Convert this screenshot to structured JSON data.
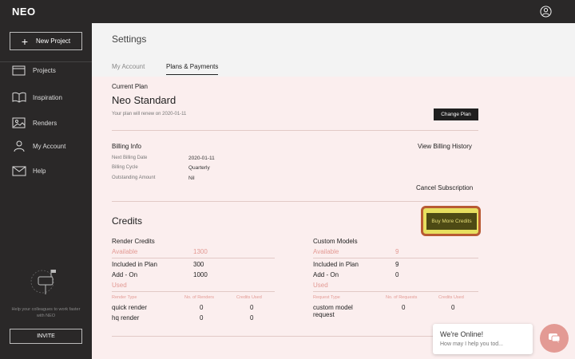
{
  "app": {
    "logo": "NEO"
  },
  "sidebar": {
    "new_project": "New Project",
    "items": [
      {
        "label": "Projects",
        "icon": "folder-icon"
      },
      {
        "label": "Inspiration",
        "icon": "book-icon"
      },
      {
        "label": "Renders",
        "icon": "image-icon"
      },
      {
        "label": "My Account",
        "icon": "user-icon"
      },
      {
        "label": "Help",
        "icon": "mail-icon"
      }
    ],
    "help_text": "Help your colleagues to work faster with NEO",
    "invite": "INVITE"
  },
  "settings": {
    "title": "Settings",
    "tabs": [
      {
        "label": "My Account"
      },
      {
        "label": "Plans & Payments",
        "active": true
      }
    ]
  },
  "plan": {
    "current_label": "Current Plan",
    "name": "Neo Standard",
    "renew_text": "Your plan will renew on 2020-01-11",
    "change_button": "Change Plan"
  },
  "billing": {
    "title": "Billing Info",
    "view_history": "View Billing History",
    "rows": [
      {
        "label": "Next Billing Date",
        "value": "2020-01-11"
      },
      {
        "label": "Billing Cycle",
        "value": "Quarterly"
      },
      {
        "label": "Outstanding Amount",
        "value": "Nil"
      }
    ],
    "cancel": "Cancel Subscription"
  },
  "credits": {
    "title": "Credits",
    "buy_button": "Buy More Credits",
    "render": {
      "title": "Render Credits",
      "available_label": "Available",
      "available_value": "1300",
      "included_label": "Included in Plan",
      "included_value": "300",
      "addon_label": "Add - On",
      "addon_value": "1000",
      "used_label": "Used",
      "cols": [
        "Render Type",
        "No. of Renders",
        "Credits Used"
      ],
      "rows": [
        {
          "type": "quick render",
          "count": "0",
          "credits": "0"
        },
        {
          "type": "hq render",
          "count": "0",
          "credits": "0"
        }
      ]
    },
    "custom": {
      "title": "Custom Models",
      "available_label": "Available",
      "available_value": "9",
      "included_label": "Included in Plan",
      "included_value": "9",
      "addon_label": "Add - On",
      "addon_value": "0",
      "used_label": "Used",
      "cols": [
        "Request   Type",
        "No. of Requests",
        "Credits Used"
      ],
      "rows": [
        {
          "type1": "custom model",
          "type2": "request",
          "count": "0",
          "credits": "0"
        }
      ]
    }
  },
  "chat": {
    "title": "We're Online!",
    "subtitle": "How may I help you tod..."
  },
  "colors": {
    "accent_pink": "#e39a94",
    "dark": "#2a2828",
    "panel": "#fbeeee",
    "highlight": "#e7df5f"
  }
}
